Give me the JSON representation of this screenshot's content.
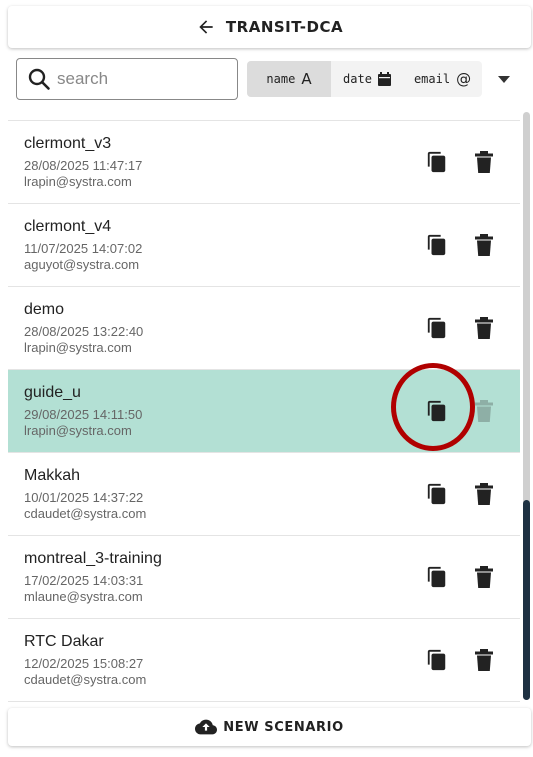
{
  "header": {
    "title": "TRANSIT-DCA",
    "back_icon": "arrow-left-icon"
  },
  "search": {
    "placeholder": "search",
    "value": ""
  },
  "sort": {
    "name_label": "name",
    "name_glyph": "A",
    "date_label": "date",
    "email_label": "email",
    "email_glyph": "@",
    "active": "name"
  },
  "scenarios": [
    {
      "name": "clermont_v3",
      "date": "28/08/2025 11:47:17",
      "email": "lrapin@systra.com",
      "selected": false
    },
    {
      "name": "clermont_v4",
      "date": "11/07/2025 14:07:02",
      "email": "aguyot@systra.com",
      "selected": false
    },
    {
      "name": "demo",
      "date": "28/08/2025 13:22:40",
      "email": "lrapin@systra.com",
      "selected": false
    },
    {
      "name": "guide_u",
      "date": "29/08/2025 14:11:50",
      "email": "lrapin@systra.com",
      "selected": true
    },
    {
      "name": "Makkah",
      "date": "10/01/2025 14:37:22",
      "email": "cdaudet@systra.com",
      "selected": false
    },
    {
      "name": "montreal_3-training",
      "date": "17/02/2025 14:03:31",
      "email": "mlaune@systra.com",
      "selected": false
    },
    {
      "name": "RTC Dakar",
      "date": "12/02/2025 15:08:27",
      "email": "cdaudet@systra.com",
      "selected": false
    }
  ],
  "footer": {
    "new_label": "NEW SCENARIO",
    "icon": "cloud-upload-icon"
  },
  "colors": {
    "selected_row": "#b3e0d4",
    "highlight_ring": "#b00000",
    "scroll_thumb": "#1e3142"
  }
}
